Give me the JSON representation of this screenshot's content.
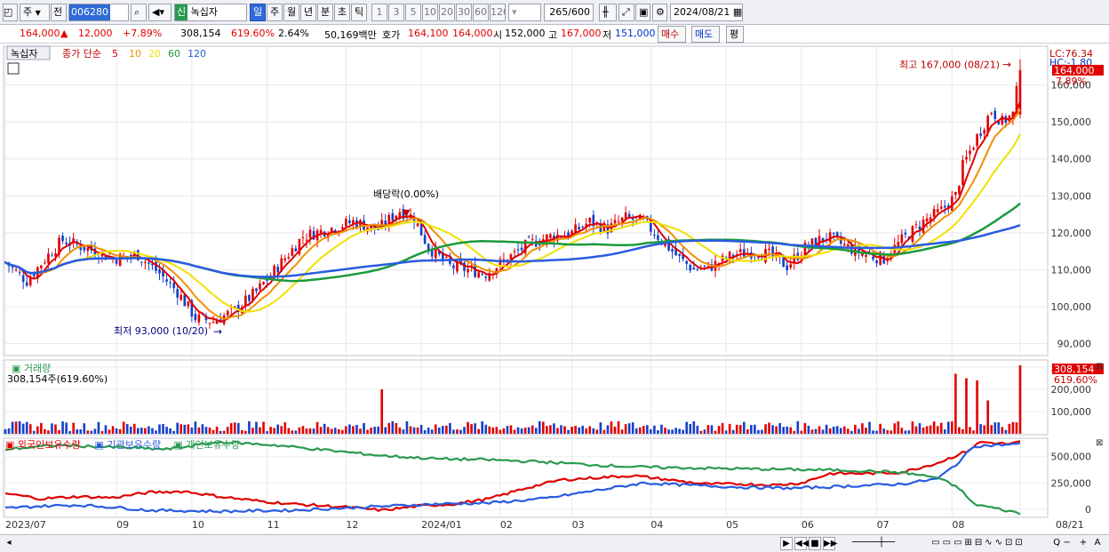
{
  "toolbar": {
    "period_type": "주",
    "period_arrow": "▼",
    "prev_label": "전",
    "code": "006280",
    "stock_badge": "신",
    "stock_name": "녹십자",
    "period_tabs": [
      "일",
      "주",
      "월",
      "년",
      "분",
      "초",
      "틱"
    ],
    "interval_buttons": [
      "1",
      "3",
      "5",
      "10",
      "20",
      "30",
      "60",
      "120"
    ],
    "count": "265",
    "count_total": "/600",
    "date": "2024/08/21"
  },
  "quote": {
    "price": "164,000",
    "change": "12,000",
    "rate": "+7.89%",
    "volume": "308,154",
    "volume_rate": "619.60%",
    "turnover": "2.64%",
    "amount": "50,169백만",
    "ask_label": "호가",
    "ask1": "164,100",
    "ask2": "164,000",
    "open_label": "시",
    "open": "152,000",
    "high_label": "고",
    "high": "167,000",
    "low_label": "저",
    "low": "151,000",
    "buy_btn": "매수",
    "sell_btn": "매도",
    "extra_btn": "평"
  },
  "legend": {
    "name": "녹십자",
    "series": "종가 단순",
    "ma": [
      "5",
      "10",
      "20",
      "60",
      "120"
    ]
  },
  "annotations": {
    "high": "최고 167,000 (08/21)",
    "low": "최저 93,000 (10/20)",
    "dividend": "배당락(0.00%)"
  },
  "right_labels": {
    "lc": "LC:76.34",
    "hc": "HC:-1.80",
    "price_tag": "164,000",
    "rate_tag": "7.89%",
    "vol_tag": "308,154",
    "vol_rate_tag": "619.60%"
  },
  "volume_panel": {
    "title": "거래량",
    "value": "308,154주(619.60%)"
  },
  "holding_panel": {
    "series": [
      "외국인보유수량",
      "기관보유수량",
      "개인보유수량"
    ]
  },
  "colors": {
    "up": "#e00000",
    "down": "#1540c8",
    "ma5": "#e00000",
    "ma10": "#f09000",
    "ma20": "#f0e000",
    "ma60": "#1a9a3a",
    "ma120": "#2a5ce0",
    "foreign": "#e00000",
    "institution": "#2a5ce0",
    "individual": "#2a9a50"
  },
  "chart_data": [
    {
      "type": "candlestick",
      "title": "",
      "y_ticks": [
        90000,
        100000,
        110000,
        120000,
        130000,
        140000,
        150000,
        160000
      ],
      "ylim": [
        87000,
        170000
      ],
      "x_ticks": [
        "2023/07",
        "09",
        "10",
        "11",
        "12",
        "2024/01",
        "02",
        "03",
        "04",
        "05",
        "06",
        "07",
        "08",
        "08/21"
      ],
      "close_anchors": [
        [
          0,
          112000
        ],
        [
          6,
          107000
        ],
        [
          12,
          114000
        ],
        [
          16,
          118000
        ],
        [
          25,
          115000
        ],
        [
          30,
          113000
        ],
        [
          37,
          114000
        ],
        [
          43,
          109000
        ],
        [
          48,
          104000
        ],
        [
          53,
          97000
        ],
        [
          58,
          96000
        ],
        [
          64,
          99000
        ],
        [
          70,
          104000
        ],
        [
          77,
          112000
        ],
        [
          83,
          119000
        ],
        [
          90,
          121000
        ],
        [
          97,
          123000
        ],
        [
          104,
          121000
        ],
        [
          110,
          126000
        ],
        [
          114,
          124000
        ],
        [
          118,
          116000
        ],
        [
          124,
          111000
        ],
        [
          129,
          110000
        ],
        [
          134,
          109000
        ],
        [
          140,
          113000
        ],
        [
          146,
          117000
        ],
        [
          152,
          119000
        ],
        [
          158,
          120000
        ],
        [
          163,
          123000
        ],
        [
          168,
          121000
        ],
        [
          173,
          124000
        ],
        [
          178,
          123000
        ],
        [
          183,
          118000
        ],
        [
          188,
          113000
        ],
        [
          192,
          110000
        ],
        [
          197,
          111000
        ],
        [
          203,
          114000
        ],
        [
          209,
          115000
        ],
        [
          213,
          114000
        ],
        [
          218,
          111000
        ],
        [
          223,
          116000
        ],
        [
          229,
          119000
        ],
        [
          235,
          116000
        ],
        [
          240,
          114000
        ],
        [
          245,
          113000
        ],
        [
          250,
          118000
        ],
        [
          256,
          123000
        ],
        [
          261,
          126000
        ],
        [
          265,
          130000
        ],
        [
          267,
          138000
        ],
        [
          271,
          146000
        ],
        [
          275,
          153000
        ],
        [
          278,
          150000
        ],
        [
          281,
          152000
        ],
        [
          283,
          164000
        ]
      ],
      "annotations": [
        {
          "text": "최고 167,000 (08/21)",
          "value": 167000
        },
        {
          "text": "최저 93,000 (10/20)",
          "value": 93000
        },
        {
          "text": "배당락(0.00%)",
          "value": 127000
        }
      ],
      "last": {
        "open": 152000,
        "high": 167000,
        "low": 151000,
        "close": 164000
      }
    },
    {
      "type": "bar",
      "title": "거래량",
      "y_ticks": [
        100000,
        200000,
        300000
      ],
      "ylim": [
        0,
        320000
      ],
      "last_value": 308154,
      "spikes": [
        [
          105,
          200000
        ],
        [
          265,
          270000
        ],
        [
          268,
          250000
        ],
        [
          271,
          240000
        ],
        [
          274,
          150000
        ],
        [
          283,
          308154
        ]
      ]
    },
    {
      "type": "line",
      "title": "",
      "y_ticks": [
        0,
        250000,
        500000
      ],
      "ylim": [
        -60000,
        650000
      ],
      "series": [
        {
          "name": "외국인보유수량",
          "anchors": [
            [
              0,
              150000
            ],
            [
              10,
              100000
            ],
            [
              20,
              120000
            ],
            [
              30,
              110000
            ],
            [
              40,
              160000
            ],
            [
              50,
              170000
            ],
            [
              60,
              120000
            ],
            [
              70,
              80000
            ],
            [
              80,
              50000
            ],
            [
              95,
              20000
            ],
            [
              105,
              -10000
            ],
            [
              115,
              30000
            ],
            [
              125,
              50000
            ],
            [
              135,
              100000
            ],
            [
              145,
              200000
            ],
            [
              155,
              280000
            ],
            [
              165,
              300000
            ],
            [
              175,
              320000
            ],
            [
              185,
              280000
            ],
            [
              195,
              240000
            ],
            [
              205,
              240000
            ],
            [
              215,
              230000
            ],
            [
              222,
              250000
            ],
            [
              230,
              340000
            ],
            [
              240,
              340000
            ],
            [
              250,
              350000
            ],
            [
              260,
              440000
            ],
            [
              268,
              550000
            ],
            [
              272,
              640000
            ],
            [
              280,
              620000
            ],
            [
              283,
              640000
            ]
          ]
        },
        {
          "name": "기관보유수량",
          "anchors": [
            [
              0,
              10000
            ],
            [
              10,
              30000
            ],
            [
              20,
              40000
            ],
            [
              30,
              20000
            ],
            [
              40,
              -10000
            ],
            [
              60,
              -20000
            ],
            [
              80,
              -10000
            ],
            [
              100,
              20000
            ],
            [
              120,
              50000
            ],
            [
              135,
              60000
            ],
            [
              150,
              100000
            ],
            [
              165,
              180000
            ],
            [
              178,
              250000
            ],
            [
              190,
              230000
            ],
            [
              205,
              210000
            ],
            [
              220,
              200000
            ],
            [
              235,
              220000
            ],
            [
              250,
              240000
            ],
            [
              260,
              290000
            ],
            [
              266,
              450000
            ],
            [
              270,
              600000
            ],
            [
              283,
              620000
            ]
          ]
        },
        {
          "name": "개인보유수량",
          "anchors": [
            [
              0,
              570000
            ],
            [
              15,
              610000
            ],
            [
              30,
              590000
            ],
            [
              45,
              570000
            ],
            [
              60,
              640000
            ],
            [
              75,
              610000
            ],
            [
              90,
              560000
            ],
            [
              105,
              510000
            ],
            [
              120,
              480000
            ],
            [
              135,
              470000
            ],
            [
              150,
              450000
            ],
            [
              165,
              420000
            ],
            [
              178,
              400000
            ],
            [
              195,
              390000
            ],
            [
              215,
              380000
            ],
            [
              235,
              370000
            ],
            [
              250,
              350000
            ],
            [
              260,
              300000
            ],
            [
              266,
              200000
            ],
            [
              270,
              50000
            ],
            [
              276,
              10000
            ],
            [
              283,
              -40000
            ]
          ]
        }
      ]
    }
  ]
}
